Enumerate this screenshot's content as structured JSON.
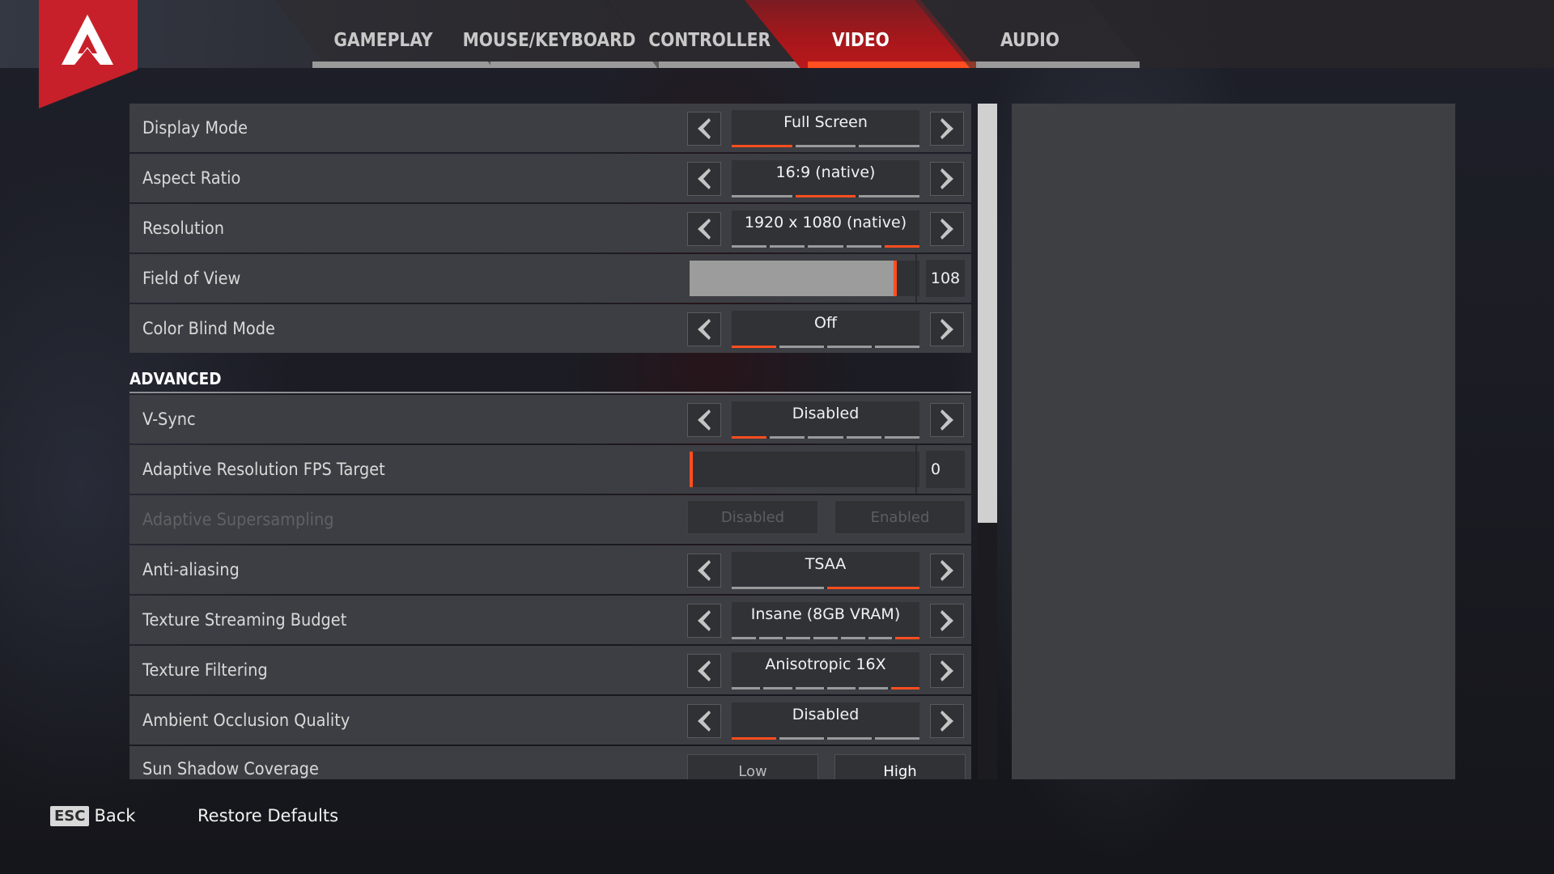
{
  "tabs": [
    {
      "label": "GAMEPLAY",
      "active": false
    },
    {
      "label": "MOUSE/KEYBOARD",
      "active": false
    },
    {
      "label": "CONTROLLER",
      "active": false
    },
    {
      "label": "VIDEO",
      "active": true
    },
    {
      "label": "AUDIO",
      "active": false
    }
  ],
  "colors": {
    "accent": "#ff4e1f",
    "logo_red": "#c8202a",
    "active_tab": "#a8171b"
  },
  "settings": {
    "display_mode": {
      "label": "Display Mode",
      "value": "Full Screen",
      "options_count": 3,
      "selected_index": 0
    },
    "aspect_ratio": {
      "label": "Aspect Ratio",
      "value": "16:9 (native)",
      "options_count": 3,
      "selected_index": 1
    },
    "resolution": {
      "label": "Resolution",
      "value": "1920 x 1080 (native)",
      "options_count": 5,
      "selected_index": 4
    },
    "field_of_view": {
      "label": "Field of View",
      "value": "108",
      "fill_fraction": 0.94
    },
    "color_blind_mode": {
      "label": "Color Blind Mode",
      "value": "Off",
      "options_count": 4,
      "selected_index": 0
    }
  },
  "advanced": {
    "title": "ADVANCED",
    "v_sync": {
      "label": "V-Sync",
      "value": "Disabled",
      "options_count": 5,
      "selected_index": 0
    },
    "adaptive_resolution": {
      "label": "Adaptive Resolution FPS Target",
      "value": "0",
      "fill_fraction": 0.0
    },
    "adaptive_supersampling": {
      "label": "Adaptive Supersampling",
      "option_a": "Disabled",
      "option_b": "Enabled",
      "disabled": true
    },
    "anti_aliasing": {
      "label": "Anti-aliasing",
      "value": "TSAA",
      "options_count": 2,
      "selected_index": 1
    },
    "texture_streaming": {
      "label": "Texture Streaming Budget",
      "value": "Insane (8GB VRAM)",
      "options_count": 7,
      "selected_index": 6
    },
    "texture_filtering": {
      "label": "Texture Filtering",
      "value": "Anisotropic 16X",
      "options_count": 6,
      "selected_index": 5
    },
    "ambient_occlusion": {
      "label": "Ambient Occlusion Quality",
      "value": "Disabled",
      "options_count": 4,
      "selected_index": 0
    },
    "sun_shadow": {
      "label": "Sun Shadow Coverage",
      "option_a": "Low",
      "option_b": "High",
      "selected": "High"
    }
  },
  "scroll": {
    "visible_fraction": 0.62,
    "position_fraction": 0.0
  },
  "footer": {
    "esc_key": "ESC",
    "back_label": "Back",
    "restore_label": "Restore Defaults"
  }
}
